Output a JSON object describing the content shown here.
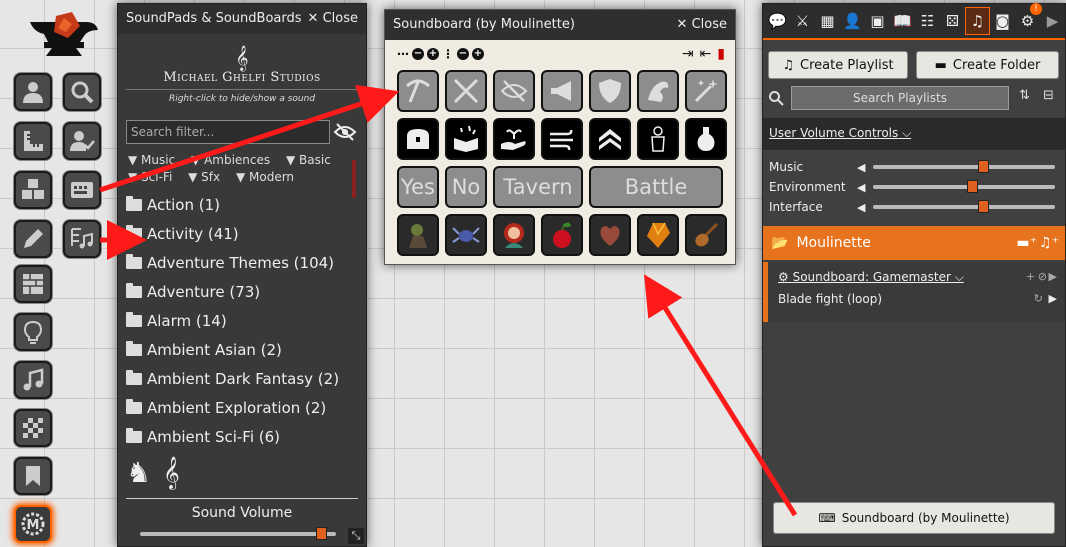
{
  "toolbar": {
    "tools": [
      "token-controls",
      "search-icon",
      "measure",
      "journal",
      "tiles",
      "roll-table",
      "drawing",
      "walls",
      "lighting",
      "sound",
      "tiles2",
      "notes",
      "moulinette"
    ]
  },
  "soundpads": {
    "title": "SoundPads & SoundBoards",
    "close_label": "Close",
    "brand_name": "Michael Ghelfi Studios",
    "hint": "Right-click to hide/show a sound",
    "filter_placeholder": "Search filter...",
    "tags": [
      "Music",
      "Ambiences",
      "Basic",
      "Sci-Fi",
      "Sfx",
      "Modern"
    ],
    "folders": [
      "Action (1)",
      "Activity (41)",
      "Adventure Themes (104)",
      "Adventure (73)",
      "Alarm (14)",
      "Ambient Asian (2)",
      "Ambient Dark Fantasy (2)",
      "Ambient Exploration (2)",
      "Ambient Sci-Fi (6)"
    ],
    "volume_label": "Sound Volume",
    "volume_level": 0.93
  },
  "soundboard": {
    "title": "Soundboard (by Moulinette)",
    "close_label": "Close",
    "text_buttons": [
      "Yes",
      "No",
      "Tavern",
      "Battle"
    ]
  },
  "sidebar": {
    "create_playlist": "Create Playlist",
    "create_folder": "Create Folder",
    "search_placeholder": "Search Playlists",
    "user_volume_controls": "User Volume Controls",
    "volumes": [
      {
        "name": "Music",
        "level": 0.61
      },
      {
        "name": "Environment",
        "level": 0.55
      },
      {
        "name": "Interface",
        "level": 0.61
      }
    ],
    "folder_name": "Moulinette",
    "playlist_title": "Soundboard: Gamemaster",
    "sound_name": "Blade fight (loop)",
    "soundboard_button": "Soundboard (by Moulinette)",
    "badge": "!"
  },
  "colors": {
    "accent": "#ff6400",
    "arrow": "#ff1a1a"
  }
}
